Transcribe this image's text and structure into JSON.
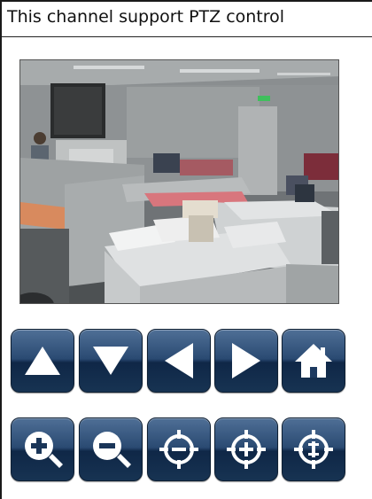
{
  "header": {
    "message": "This channel support PTZ control"
  },
  "camera_view": {
    "description_icon": "camera-feed-icon"
  },
  "ptz_controls": {
    "row1": [
      "tilt-up-icon",
      "tilt-down-icon",
      "pan-left-icon",
      "pan-right-icon",
      "home-icon"
    ],
    "row2": [
      "zoom-in-icon",
      "zoom-out-icon",
      "focus-near-icon",
      "focus-far-icon",
      "auto-focus-icon"
    ]
  },
  "colors": {
    "button_top": "#4f6f96",
    "button_bottom": "#0f2747",
    "icon": "#ffffff"
  }
}
